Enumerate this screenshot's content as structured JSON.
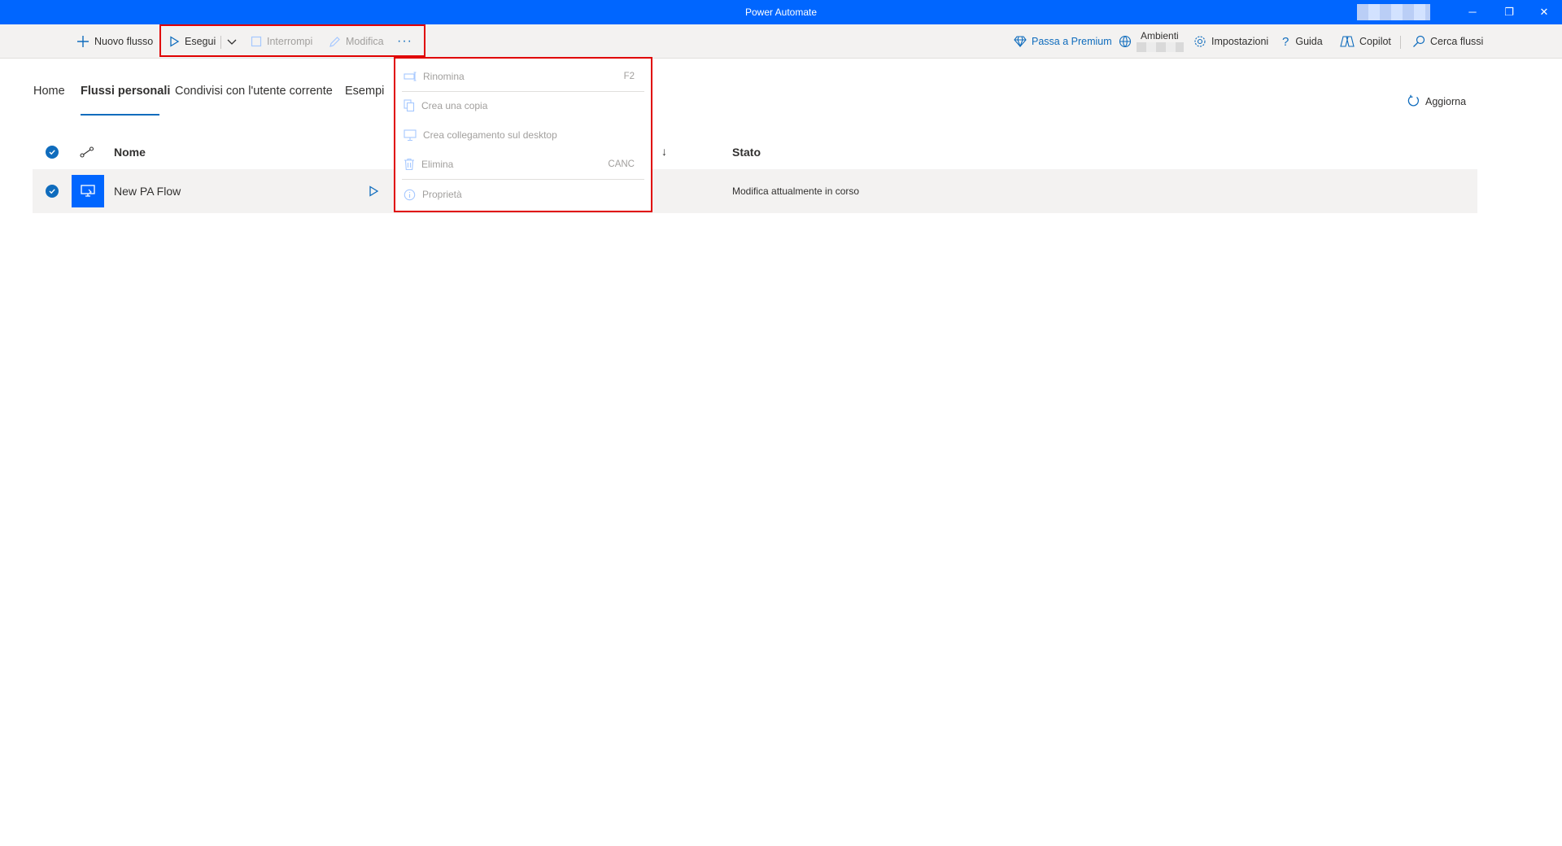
{
  "window": {
    "title": "Power Automate",
    "minimize": "─",
    "restore": "❐",
    "close": "✕"
  },
  "toolbar": {
    "new_flow": "Nuovo flusso",
    "run": "Esegui",
    "stop": "Interrompi",
    "edit": "Modifica",
    "more": "···",
    "premium": "Passa a Premium",
    "environments": "Ambienti",
    "settings": "Impostazioni",
    "help": "Guida",
    "copilot": "Copilot",
    "search": "Cerca flussi"
  },
  "tabs": [
    {
      "label": "Home"
    },
    {
      "label": "Flussi personali"
    },
    {
      "label": "Condivisi con l'utente corrente"
    },
    {
      "label": "Esempi"
    }
  ],
  "refresh": "Aggiorna",
  "table": {
    "columns": {
      "name": "Nome",
      "sort_arrow": "↓",
      "status": "Stato"
    },
    "rows": [
      {
        "name": "New PA Flow",
        "status": "Modifica attualmente in corso"
      }
    ]
  },
  "context_menu": {
    "items": [
      {
        "label": "Rinomina",
        "shortcut": "F2"
      },
      {
        "label": "Crea una copia",
        "shortcut": ""
      },
      {
        "label": "Crea collegamento sul desktop",
        "shortcut": ""
      },
      {
        "label": "Elimina",
        "shortcut": "CANC"
      },
      {
        "label": "Proprietà",
        "shortcut": ""
      }
    ]
  },
  "colors": {
    "brand": "#0066ff",
    "accent": "#0f6cbd",
    "highlight": "#e00000"
  }
}
